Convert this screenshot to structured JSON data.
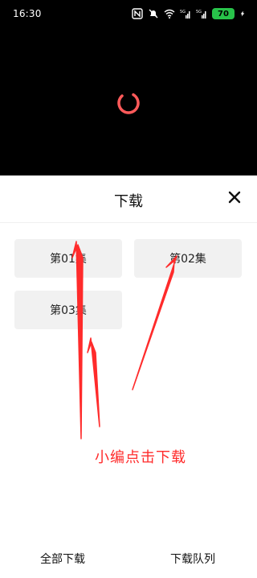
{
  "status_bar": {
    "time": "16:30",
    "battery": "70",
    "icons": [
      "nfc-icon",
      "mute-icon",
      "wifi-icon",
      "signal-5g-icon",
      "signal-5g-icon",
      "battery-icon",
      "charging-icon"
    ],
    "battery_color": "#28c34a"
  },
  "player": {
    "background": "#000000",
    "spinner_color": "#ff5a5a",
    "spinner_icon": "loading-spinner-icon"
  },
  "sheet": {
    "title": "下载",
    "close_icon": "close-icon",
    "episodes": [
      {
        "label": "第01集"
      },
      {
        "label": "第02集"
      },
      {
        "label": "第03集"
      }
    ]
  },
  "annotation": {
    "text": "小编点击下载",
    "color": "#ff2b2b"
  },
  "bottom_bar": {
    "download_all": "全部下载",
    "download_queue": "下载队列"
  }
}
